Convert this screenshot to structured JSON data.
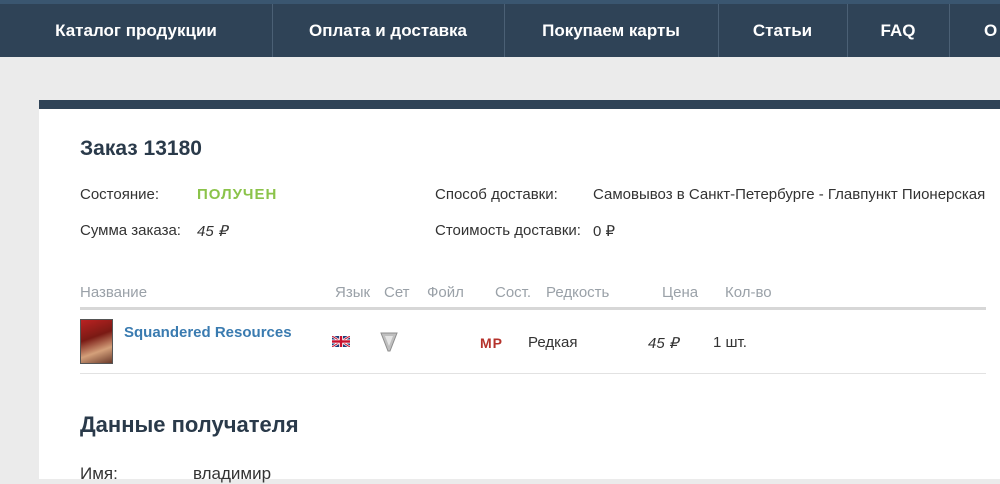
{
  "nav": {
    "items": [
      {
        "label": "Каталог продукции"
      },
      {
        "label": "Оплата и доставка"
      },
      {
        "label": "Покупаем карты"
      },
      {
        "label": "Статьи"
      },
      {
        "label": "FAQ"
      },
      {
        "label": "О"
      }
    ]
  },
  "order": {
    "title": "Заказ 13180",
    "status_label": "Состояние:",
    "status_value": "ПОЛУЧЕН",
    "sum_label": "Сумма заказа:",
    "sum_value": "45 ₽",
    "delivery_method_label": "Способ доставки:",
    "delivery_method_value": "Самовывоз в Санкт-Петербурге - Главпункт Пионерская",
    "delivery_cost_label": "Стоимость доставки:",
    "delivery_cost_value": "0 ₽"
  },
  "table": {
    "headers": {
      "name": "Название",
      "lang": "Язык",
      "set": "Сет",
      "foil": "Фойл",
      "cond": "Сост.",
      "rarity": "Редкость",
      "price": "Цена",
      "qty": "Кол-во"
    },
    "rows": [
      {
        "name": "Squandered Resources",
        "lang_icon": "uk-flag-icon",
        "set_icon": "set-symbol-icon",
        "foil": "",
        "cond": "MP",
        "rarity": "Редкая",
        "price": "45 ₽",
        "qty": "1 шт."
      }
    ]
  },
  "recipient": {
    "title": "Данные получателя",
    "name_label": "Имя:",
    "name_value": "владимир"
  },
  "colors": {
    "nav_bg": "#2f4357",
    "status_green": "#8bc34a",
    "link_blue": "#3a7bb0",
    "cond_red": "#b5322b"
  }
}
